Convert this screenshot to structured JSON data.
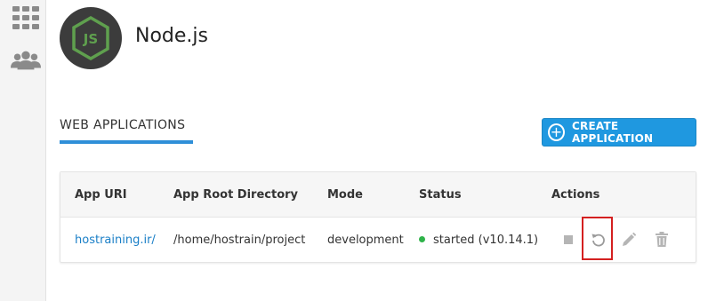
{
  "sidebar": {
    "items": [
      {
        "icon": "grid-icon"
      },
      {
        "icon": "users-icon"
      }
    ]
  },
  "app": {
    "title": "Node.js",
    "logo_text": "JS",
    "logo_color": "#5fa04e"
  },
  "section": {
    "tab_label": "WEB APPLICATIONS"
  },
  "toolbar": {
    "create_label": "CREATE APPLICATION",
    "accent": "#1f98e0"
  },
  "table": {
    "columns": [
      "App URI",
      "App Root Directory",
      "Mode",
      "Status",
      "Actions"
    ],
    "rows": [
      {
        "app_uri": "hostraining.ir/",
        "root_dir": "/home/hostrain/project",
        "mode": "development",
        "status": "started (v10.14.1)",
        "status_color": "#2fb34a",
        "actions": [
          "stop-icon",
          "restart-icon",
          "edit-icon",
          "trash-icon"
        ]
      }
    ]
  }
}
